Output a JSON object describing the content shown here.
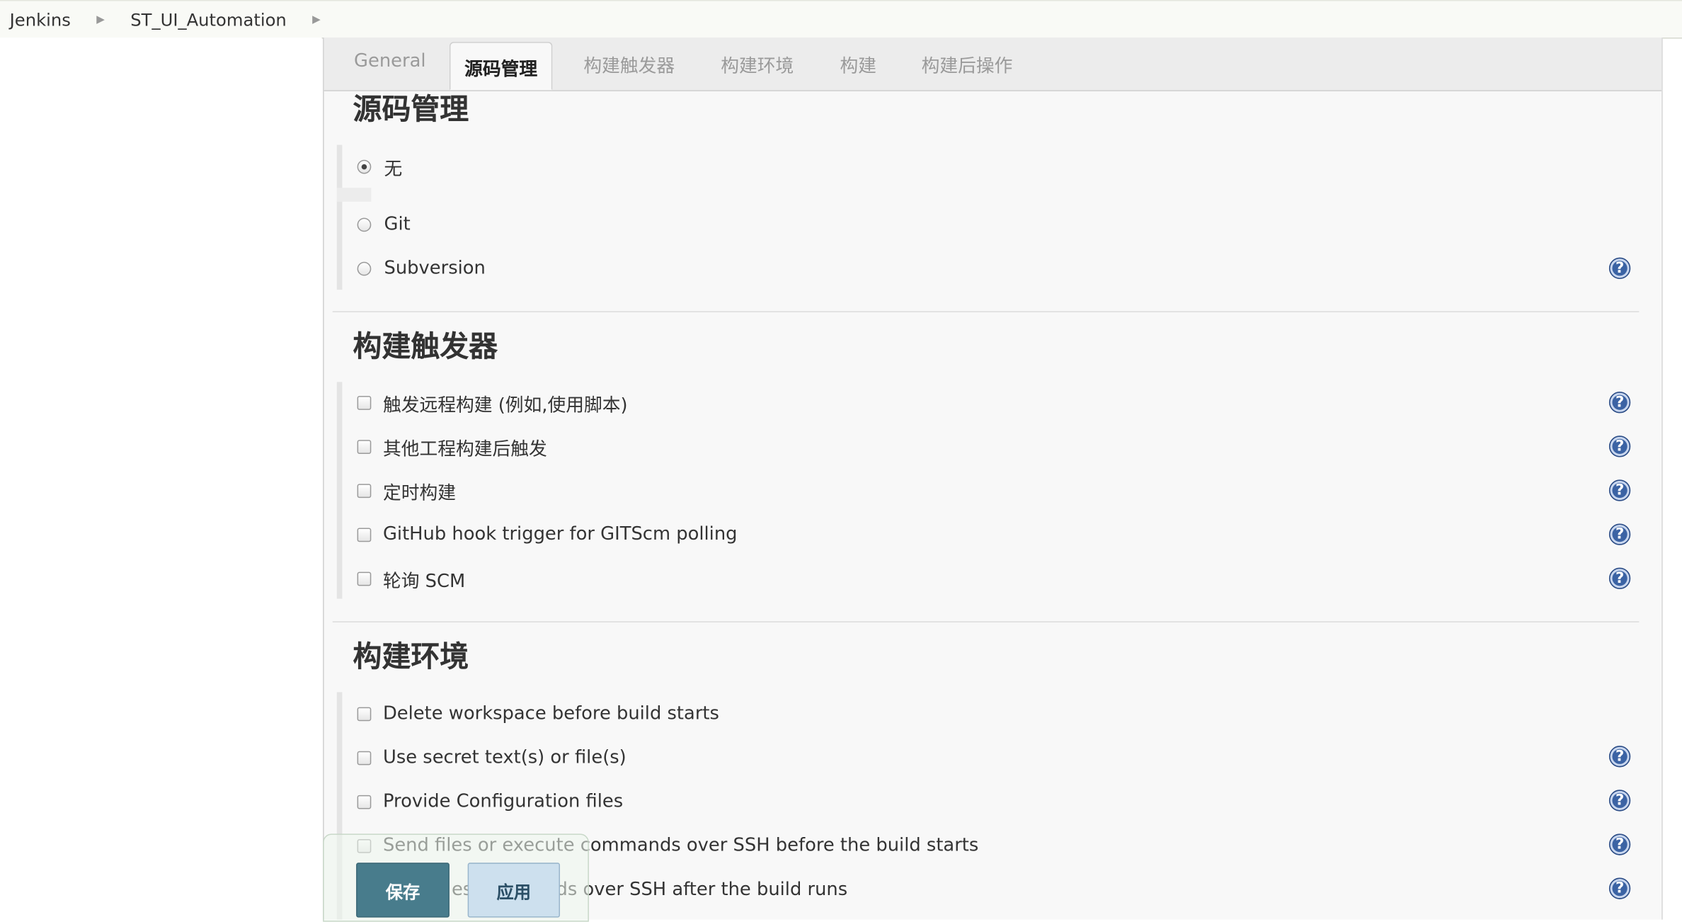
{
  "breadcrumb": {
    "items": [
      "Jenkins",
      "ST_UI_Automation"
    ]
  },
  "tabs": [
    "General",
    "源码管理",
    "构建触发器",
    "构建环境",
    "构建",
    "构建后操作"
  ],
  "active_tab": "源码管理",
  "scm": {
    "title": "源码管理",
    "options": [
      "无",
      "Git",
      "Subversion"
    ],
    "selected": "无"
  },
  "triggers": {
    "title": "构建触发器",
    "options": [
      "触发远程构建 (例如,使用脚本)",
      "其他工程构建后触发",
      "定时构建",
      "GitHub hook trigger for GITScm polling",
      "轮询 SCM"
    ]
  },
  "build_env": {
    "title": "构建环境",
    "options": [
      "Delete workspace before build starts",
      "Use secret text(s) or file(s)",
      "Provide Configuration files",
      "Send files or execute commands over SSH before the build starts",
      "commands over SSH after the build runs"
    ],
    "partial_prefix_4": "es"
  },
  "help_icon_glyph": "?",
  "buttons": {
    "save": "保存",
    "apply": "应用"
  },
  "colors": {
    "save_bg": "#487c8c",
    "apply_bg": "#cde0ee",
    "help_icon": "#3b63a4"
  }
}
